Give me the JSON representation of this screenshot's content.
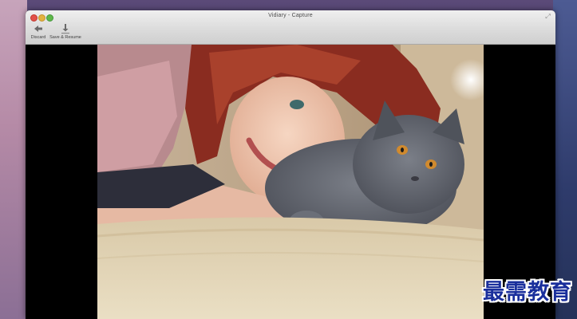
{
  "window": {
    "title": "Vidiary - Capture"
  },
  "toolbar": {
    "discard_label": "Discard",
    "save_label": "Save & Resume",
    "discard_icon": "arrow-left-icon",
    "save_icon": "download-arrow-icon"
  },
  "watermark": {
    "text": "最需教育"
  },
  "colors": {
    "close": "#e2514a",
    "minimize": "#e3b340",
    "zoom": "#5fb84a",
    "watermark": "#1a2f9c"
  }
}
